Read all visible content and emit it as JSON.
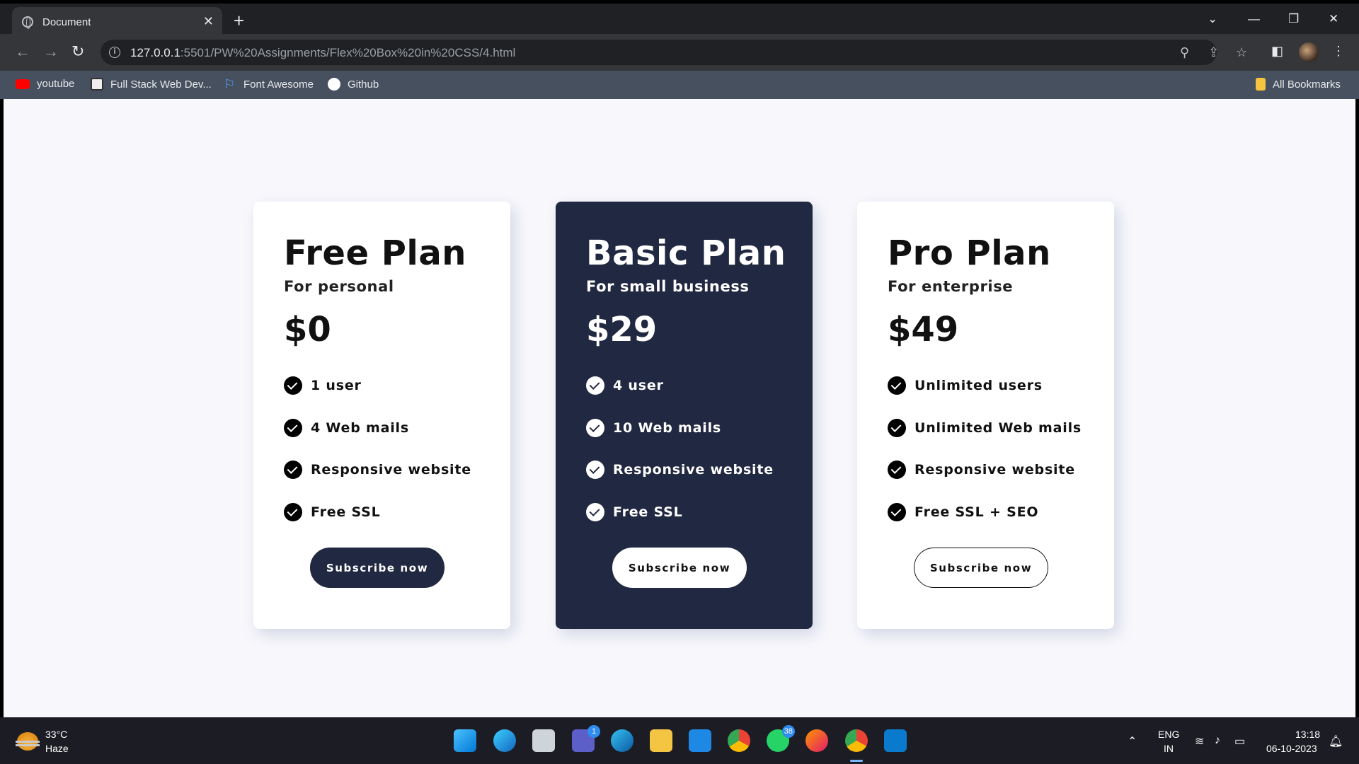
{
  "browser": {
    "tab_title": "Document",
    "url_host": "127.0.0.1",
    "url_path": ":5501/PW%20Assignments/Flex%20Box%20in%20CSS/4.html",
    "bookmarks": [
      {
        "label": "youtube",
        "icon": "youtube-icon"
      },
      {
        "label": "Full Stack Web Dev...",
        "icon": "bookmark-favicon-icon"
      },
      {
        "label": "Font Awesome",
        "icon": "flag-icon"
      },
      {
        "label": "Github",
        "icon": "github-icon"
      }
    ],
    "all_bookmarks_label": "All Bookmarks"
  },
  "plans": [
    {
      "name": "Free Plan",
      "subtitle": "For personal",
      "price": "$0",
      "features": [
        "1 user",
        "4 Web mails",
        "Responsive website",
        "Free SSL"
      ],
      "button": "Subscribe now",
      "theme": "light"
    },
    {
      "name": "Basic Plan",
      "subtitle": "For small business",
      "price": "$29",
      "features": [
        "4 user",
        "10 Web mails",
        "Responsive website",
        "Free SSL"
      ],
      "button": "Subscribe now",
      "theme": "dark"
    },
    {
      "name": "Pro Plan",
      "subtitle": "For enterprise",
      "price": "$49",
      "features": [
        "Unlimited users",
        "Unlimited Web mails",
        "Responsive website",
        "Free SSL + SEO"
      ],
      "button": "Subscribe now",
      "theme": "light"
    }
  ],
  "taskbar": {
    "temperature": "33°C",
    "weather": "Haze",
    "teams_badge": "1",
    "whatsapp_badge": "38",
    "language": "ENG",
    "region": "IN",
    "time": "13:18",
    "date": "06-10-2023"
  },
  "colors": {
    "dark_card": "#212841",
    "page_bg": "#f8f8fc",
    "chrome_dark": "#202124",
    "bookmarks_bar": "#46505e"
  }
}
